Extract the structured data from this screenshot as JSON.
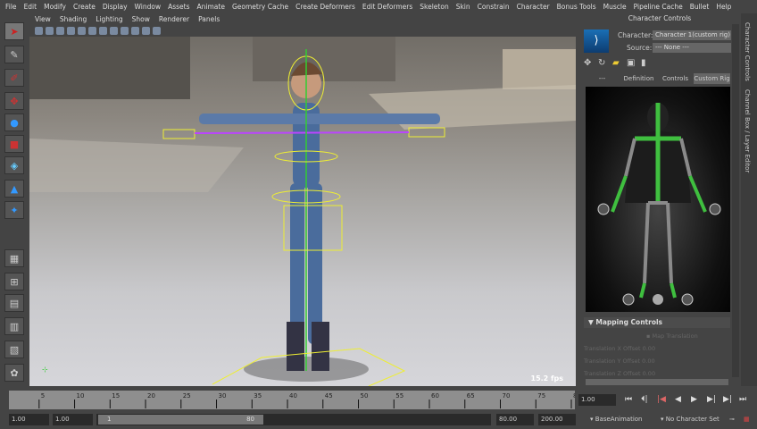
{
  "menu": [
    "File",
    "Edit",
    "Modify",
    "Create",
    "Display",
    "Window",
    "Assets",
    "Animate",
    "Geometry Cache",
    "Create Deformers",
    "Edit Deformers",
    "Skeleton",
    "Skin",
    "Constrain",
    "Character",
    "Bonus Tools",
    "Muscle",
    "Pipeline Cache",
    "Bullet",
    "Help"
  ],
  "viewport": {
    "menu": [
      "View",
      "Shading",
      "Lighting",
      "Show",
      "Renderer",
      "Panels"
    ],
    "fps": "15.2 fps"
  },
  "panel": {
    "title": "Character Controls",
    "character_label": "Character:",
    "character_value": "Character 1(custom rig)",
    "source_label": "Source:",
    "source_value": "--- None ---",
    "tabs": [
      "---",
      "Definition",
      "Controls",
      "Custom Rig"
    ],
    "active_tab": "Custom Rig",
    "mapping": {
      "title": "Mapping Controls",
      "map_translation": "Map Translation",
      "rows": [
        {
          "label": "Translation X Offset",
          "value": "0.00"
        },
        {
          "label": "Translation Y Offset",
          "value": "0.00"
        },
        {
          "label": "Translation Z Offset",
          "value": "0.00"
        }
      ]
    }
  },
  "sidetabs": [
    "Character Controls",
    "Channel Box / Layer Editor"
  ],
  "timeline": {
    "ticks": [
      5,
      10,
      15,
      20,
      25,
      30,
      35,
      40,
      45,
      50,
      55,
      60,
      65,
      70,
      75,
      80
    ],
    "current": "1.00"
  },
  "range": {
    "start": "1.00",
    "anim_start": "1.00",
    "slider_start": "1",
    "slider_end": "80",
    "end": "80.00",
    "anim_end": "200.00"
  },
  "status": {
    "anim_layer": "BaseAnimation",
    "character_set": "No Character Set"
  },
  "colors": {
    "rig_active": "#3fbf3f",
    "rig_inactive": "#8a8a8a",
    "tab_active": "#666666"
  }
}
